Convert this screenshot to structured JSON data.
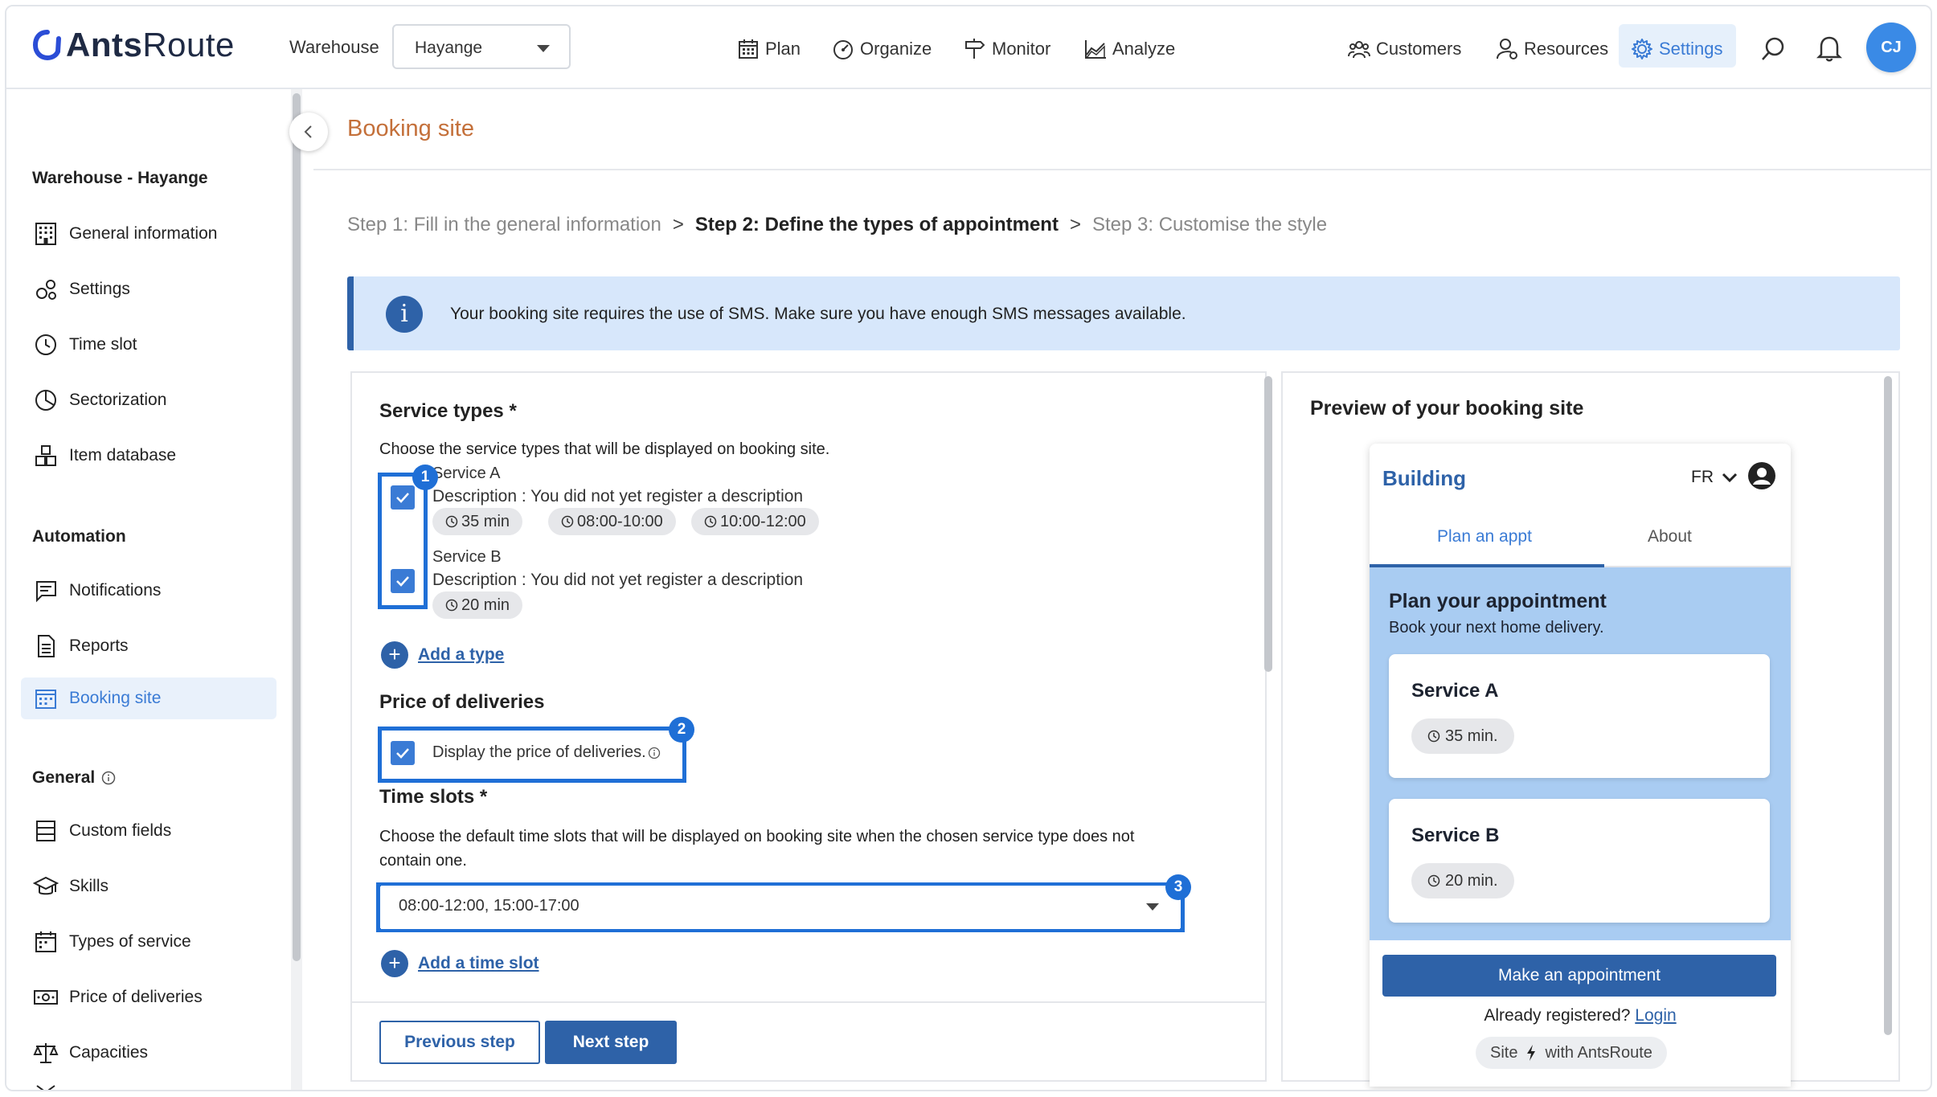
{
  "app": {
    "logo_text_bold": "Ants",
    "logo_text_rest": "Route",
    "warehouse_label": "Warehouse",
    "warehouse_value": "Hayange",
    "avatar_initials": "CJ"
  },
  "topnav": {
    "plan": "Plan",
    "organize": "Organize",
    "monitor": "Monitor",
    "analyze": "Analyze",
    "customers": "Customers",
    "resources": "Resources",
    "settings": "Settings"
  },
  "sidebar": {
    "section_warehouse": "Warehouse - Hayange",
    "section_automation": "Automation",
    "section_general": "General",
    "items": {
      "general_information": "General information",
      "settings": "Settings",
      "time_slot": "Time slot",
      "sectorization": "Sectorization",
      "item_database": "Item database",
      "notifications": "Notifications",
      "reports": "Reports",
      "booking_site": "Booking site",
      "custom_fields": "Custom fields",
      "skills": "Skills",
      "types_of_service": "Types of service",
      "price_of_deliveries": "Price of deliveries",
      "capacities": "Capacities"
    }
  },
  "page": {
    "title": "Booking site",
    "step1": "Step 1: Fill in the general information",
    "step2": "Step 2: Define the types of appointment",
    "step3": "Step 3: Customise the style",
    "step_sep": ">",
    "banner_icon": "i",
    "banner_text": "Your booking site requires the use of SMS. Make sure you have enough SMS messages available."
  },
  "form": {
    "service_types_title": "Service types *",
    "service_types_desc": "Choose the service types that will be displayed on booking site.",
    "services": [
      {
        "name": "Service A",
        "description": "Description : You did not yet register a description",
        "chips": [
          "35 min",
          "08:00-10:00",
          "10:00-12:00"
        ],
        "checked": true
      },
      {
        "name": "Service B",
        "description": "Description : You did not yet register a description",
        "chips": [
          "20 min"
        ],
        "checked": true
      }
    ],
    "add_type": "Add a type",
    "price_title": "Price of deliveries",
    "price_checkbox_label": "Display the price of deliveries.",
    "time_slots_title": "Time slots *",
    "time_slots_desc": "Choose the default time slots that will be displayed on booking site when the chosen service type does not contain one.",
    "time_slots_value": "08:00-12:00, 15:00-17:00",
    "add_time_slot": "Add a time slot",
    "prev_button": "Previous step",
    "next_button": "Next step",
    "badges": [
      "1",
      "2",
      "3"
    ],
    "highlight_color": "#1f6fd6"
  },
  "preview": {
    "title": "Preview of your booking site",
    "brand": "Building",
    "lang": "FR",
    "tab_plan": "Plan an appt",
    "tab_about": "About",
    "heading": "Plan your appointment",
    "subheading": "Book your next home delivery.",
    "cards": [
      {
        "name": "Service A",
        "duration": "35 min."
      },
      {
        "name": "Service B",
        "duration": "20 min."
      }
    ],
    "button": "Make an appointment",
    "registered_text": "Already registered?",
    "login": "Login",
    "site_label": "Site",
    "site_suffix": "with AntsRoute"
  },
  "colors": {
    "accent": "#2e62a8",
    "title_orange": "#c4703a",
    "banner_bg": "#d7e7fb",
    "preview_blue": "#a9ccf2"
  }
}
